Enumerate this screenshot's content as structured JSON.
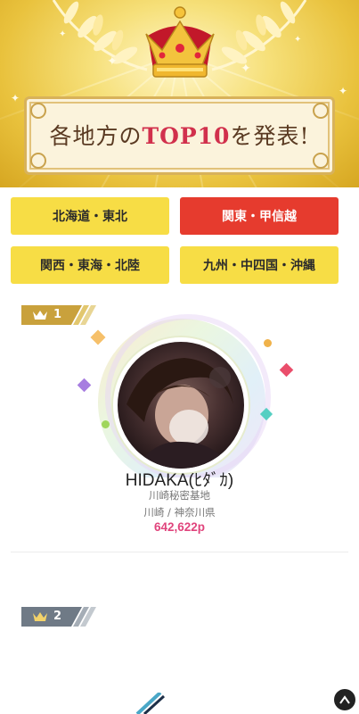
{
  "banner": {
    "title_prefix": "各地方の",
    "title_top": "TOP10",
    "title_suffix": "を発表!"
  },
  "regions": [
    {
      "label": "北海道・東北",
      "active": false
    },
    {
      "label": "関東・甲信越",
      "active": true
    },
    {
      "label": "関西・東海・北陸",
      "active": false
    },
    {
      "label": "九州・中四国・沖縄",
      "active": false
    }
  ],
  "ranking": [
    {
      "rank": "1",
      "name": "HIDAKA(ﾋﾀﾞｶ)",
      "shop": "川崎秘密基地",
      "area": "川崎 / 神奈川県",
      "points": "642,622p"
    },
    {
      "rank": "2"
    }
  ],
  "colors": {
    "accent_yellow": "#f7dd45",
    "accent_red": "#e63b2e",
    "points_pink": "#e0447c",
    "rank1_gold": "#c9a13c",
    "rank2_silver": "#6f7a86"
  },
  "icons": {
    "crown": "crown-icon",
    "scroll_top": "scroll-top-icon"
  }
}
